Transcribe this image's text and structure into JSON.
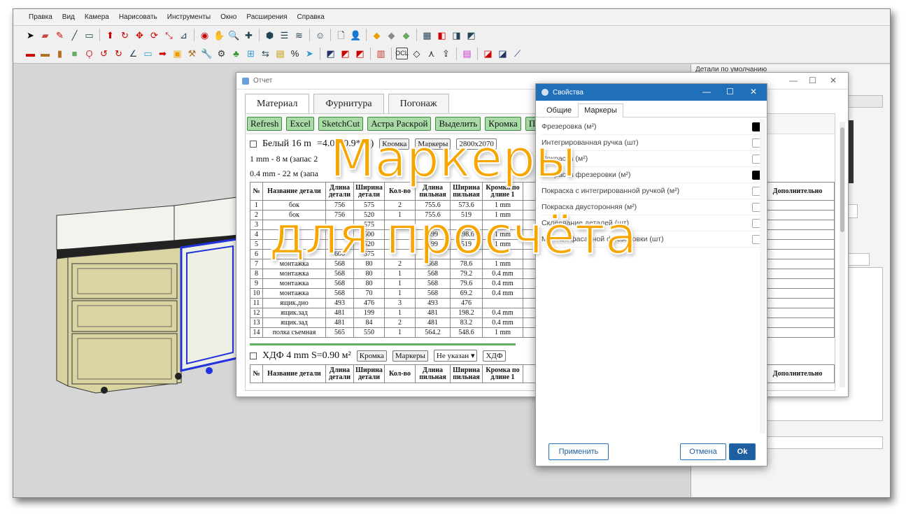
{
  "menu": [
    "Правка",
    "Вид",
    "Камера",
    "Нарисовать",
    "Инструменты",
    "Окно",
    "Расширения",
    "Справка"
  ],
  "right_panel": {
    "title": "Детали по умолчанию"
  },
  "report": {
    "title": "Отчет",
    "tabs": [
      "Материал",
      "Фурнитура",
      "Погонаж"
    ],
    "buttons": [
      "Refresh",
      "Excel",
      "SketchCut",
      "Астра Раскрой",
      "Выделить",
      "Кромка",
      "При"
    ],
    "material1": {
      "name": "Белый 16 m",
      "area": "=4.0",
      "sheets": "(0.9* л.)",
      "kromka": "Кромка",
      "markery": "Маркеры",
      "size": "2800x2070"
    },
    "info1": "1 mm - 8 м (запас 2",
    "info2": "0.4 mm - 22 м (запа",
    "headers": [
      "№",
      "Название детали",
      "Длина детали",
      "Ширина детали",
      "Кол-во",
      "Длина пильная",
      "Ширина пильная",
      "Кромка по длине 1",
      "Дополнительно"
    ],
    "rows": [
      [
        "1",
        "бок",
        "756",
        "575",
        "2",
        "755.6",
        "573.6",
        "1 mm"
      ],
      [
        "2",
        "бок",
        "756",
        "520",
        "1",
        "755.6",
        "519",
        "1 mm"
      ],
      [
        "3",
        "",
        "",
        "575",
        "",
        "",
        "",
        ""
      ],
      [
        "4",
        "",
        "",
        "500",
        "",
        "599",
        "498.6",
        "1 mm"
      ],
      [
        "5",
        "",
        "",
        "520",
        "",
        "599",
        "519",
        "1 mm"
      ],
      [
        "6",
        "",
        "600",
        "575",
        "",
        "",
        "",
        ""
      ],
      [
        "7",
        "монтажка",
        "568",
        "80",
        "2",
        "568",
        "78.6",
        "1 mm"
      ],
      [
        "8",
        "монтажка",
        "568",
        "80",
        "1",
        "568",
        "79.2",
        "0.4 mm"
      ],
      [
        "9",
        "монтажка",
        "568",
        "80",
        "1",
        "568",
        "79.6",
        "0.4 mm"
      ],
      [
        "10",
        "монтажка",
        "568",
        "70",
        "1",
        "568",
        "69.2",
        "0.4 mm"
      ],
      [
        "11",
        "ящик.дно",
        "493",
        "476",
        "3",
        "493",
        "476",
        ""
      ],
      [
        "12",
        "ящик.зад",
        "481",
        "199",
        "1",
        "481",
        "198.2",
        "0.4 mm"
      ],
      [
        "13",
        "ящик.зад",
        "481",
        "84",
        "2",
        "481",
        "83.2",
        "0.4 mm"
      ],
      [
        "14",
        "полка съемная",
        "565",
        "550",
        "1",
        "564.2",
        "548.6",
        "1 mm"
      ]
    ],
    "material2": {
      "name": "ХДФ 4 mm S=0.90 м²",
      "kromka": "Кромка",
      "markery": "Маркеры",
      "select1": "Не указан",
      "select2": "ХДФ"
    },
    "headers2": [
      "№",
      "Название детали",
      "Длина детали",
      "Ширина детали",
      "Кол-во",
      "Длина пильная",
      "Ширина пильная",
      "Кромка по длине 1",
      "Дополнительно"
    ]
  },
  "props": {
    "title": "Свойства",
    "tabs": [
      "Общие",
      "Маркеры"
    ],
    "items": [
      {
        "label": "Фрезеровка (м²)",
        "checked": true
      },
      {
        "label": "Интегрированная ручка (шт)",
        "checked": false
      },
      {
        "label": "Покраска (м²)",
        "checked": false
      },
      {
        "label": "Покраска фрезеровки (м²)",
        "checked": true
      },
      {
        "label": "Покраска с интегрированной ручкой (м²)",
        "checked": false
      },
      {
        "label": "Покраска двусторонняя (м²)",
        "checked": false
      },
      {
        "label": "Склеевание деталей (шт)",
        "checked": false
      },
      {
        "label": "Монтаж фасадной фрезеровки (шт)",
        "checked": false
      }
    ],
    "apply": "Применить",
    "cancel": "Отмена",
    "ok": "Ok"
  },
  "overlay": {
    "line1": "Маркеры",
    "line2": "для просчёта",
    "color": "#f7a600"
  }
}
